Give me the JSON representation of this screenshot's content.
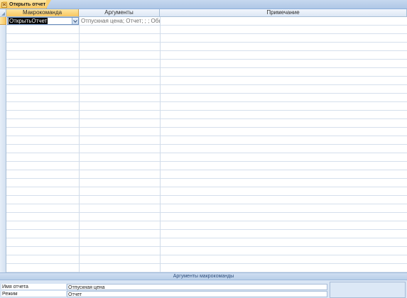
{
  "tab": {
    "title": "Открыть отчет",
    "icon": "macro-icon"
  },
  "grid": {
    "columns": [
      {
        "label": "Макрокоманда",
        "active": true
      },
      {
        "label": "Аргументы",
        "active": false
      },
      {
        "label": "Примечание",
        "active": false
      }
    ],
    "rows": [
      {
        "action": "ОткрытьОтчет",
        "arguments": "Отпускная цена; Отчет; ; ; Обычное"
      }
    ]
  },
  "args_panel": {
    "title": "Аргументы макрокоманды",
    "fields": [
      {
        "label": "Имя отчета",
        "value": "Отпускная цена"
      },
      {
        "label": "Режим",
        "value": "Отчет"
      }
    ]
  },
  "colors": {
    "header_blue": "#dce7f5",
    "active_header": "#f9c760",
    "panel_bg": "#d9e5f4",
    "panel_title": "#2c4c7a"
  }
}
